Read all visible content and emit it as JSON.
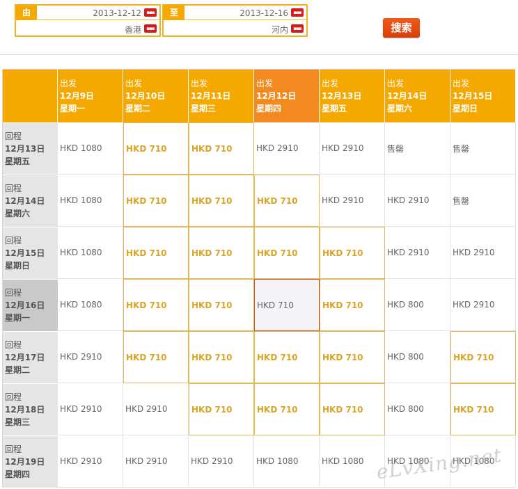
{
  "search": {
    "from_label": "由",
    "to_label": "至",
    "from_date": "2013-12-12",
    "to_date": "2013-12-16",
    "from_city": "香港",
    "to_city": "河内",
    "calendar_icon": "calendar-icon",
    "button_label": "搜索"
  },
  "grid": {
    "depart_label": "出发",
    "return_label": "回程",
    "depart_dates": [
      {
        "date": "12月9日",
        "weekday": "星期一"
      },
      {
        "date": "12月10日",
        "weekday": "星期二"
      },
      {
        "date": "12月11日",
        "weekday": "星期三"
      },
      {
        "date": "12月12日",
        "weekday": "星期四"
      },
      {
        "date": "12月13日",
        "weekday": "星期五"
      },
      {
        "date": "12月14日",
        "weekday": "星期六"
      },
      {
        "date": "12月15日",
        "weekday": "星期日"
      }
    ],
    "selected_depart_index": 3,
    "selected_return_index": 3,
    "rows": [
      {
        "date": "12月13日",
        "weekday": "星期五",
        "prices": [
          "HKD 1080",
          "HKD 710",
          "HKD 710",
          "HKD 2910",
          "HKD 2910",
          "售罄",
          "售罄"
        ],
        "low": [
          false,
          true,
          true,
          false,
          false,
          false,
          false
        ]
      },
      {
        "date": "12月14日",
        "weekday": "星期六",
        "prices": [
          "HKD 1080",
          "HKD 710",
          "HKD 710",
          "HKD 710",
          "HKD 2910",
          "HKD 2910",
          "售罄"
        ],
        "low": [
          false,
          true,
          true,
          true,
          false,
          false,
          false
        ]
      },
      {
        "date": "12月15日",
        "weekday": "星期日",
        "prices": [
          "HKD 1080",
          "HKD 710",
          "HKD 710",
          "HKD 710",
          "HKD 710",
          "HKD 2910",
          "HKD 2910"
        ],
        "low": [
          false,
          true,
          true,
          true,
          true,
          false,
          false
        ]
      },
      {
        "date": "12月16日",
        "weekday": "星期一",
        "prices": [
          "HKD 1080",
          "HKD 710",
          "HKD 710",
          "HKD 710",
          "HKD 710",
          "HKD 800",
          "HKD 2910"
        ],
        "low": [
          false,
          true,
          true,
          false,
          true,
          false,
          false
        ]
      },
      {
        "date": "12月17日",
        "weekday": "星期二",
        "prices": [
          "HKD 2910",
          "HKD 710",
          "HKD 710",
          "HKD 710",
          "HKD 710",
          "HKD 800",
          "HKD 710"
        ],
        "low": [
          false,
          true,
          true,
          true,
          true,
          false,
          true
        ]
      },
      {
        "date": "12月18日",
        "weekday": "星期三",
        "prices": [
          "HKD 2910",
          "HKD 2910",
          "HKD 710",
          "HKD 710",
          "HKD 710",
          "HKD 800",
          "HKD 710"
        ],
        "low": [
          false,
          false,
          true,
          true,
          true,
          false,
          true
        ]
      },
      {
        "date": "12月19日",
        "weekday": "星期四",
        "prices": [
          "HKD 2910",
          "HKD 2910",
          "HKD 2910",
          "HKD 1080",
          "HKD 1080",
          "HKD 1080",
          "HKD 1080"
        ],
        "low": [
          false,
          false,
          false,
          false,
          false,
          false,
          false
        ]
      }
    ]
  },
  "watermark": "eLvXing.net",
  "colors": {
    "accent": "#f5a800",
    "selected_header": "#f28a20",
    "low_price": "#d9a526",
    "search_button": "#e34e12"
  }
}
